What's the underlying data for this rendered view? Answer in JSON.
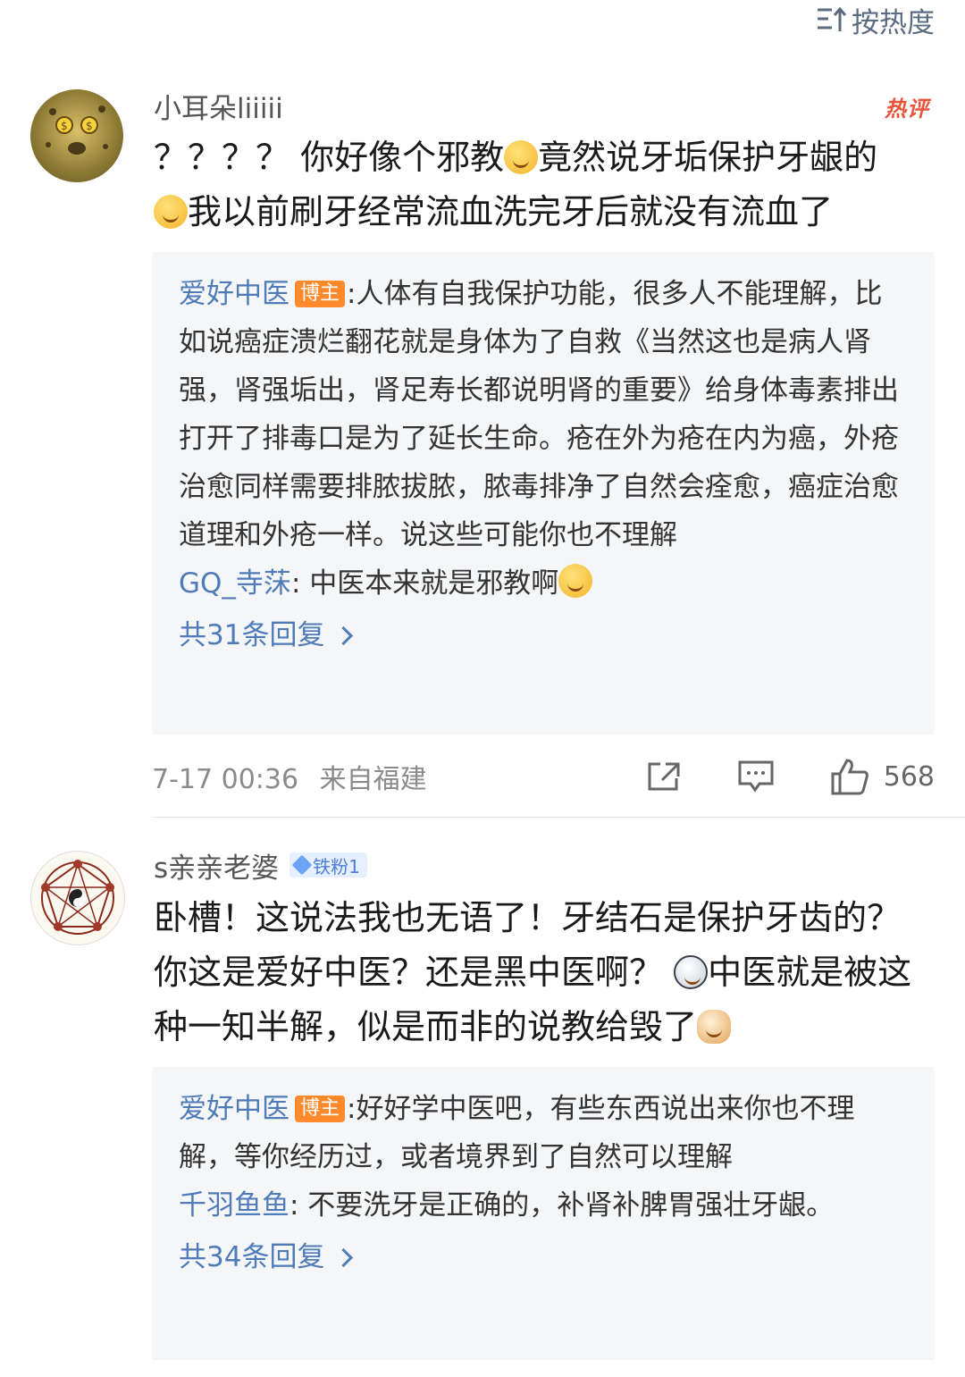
{
  "sort": {
    "label": "按热度"
  },
  "comments": [
    {
      "username": "小耳朵liiiii",
      "hot_label": "热评",
      "text_parts": [
        "？？？？ 你好像个邪教",
        "竟然说牙垢保护牙龈的",
        "我以前刷牙经常流血洗完牙后就没有流血了"
      ],
      "replies": [
        {
          "name": "爱好中医",
          "badge": "博主",
          "text": ":人体有自我保护功能，很多人不能理解，比如说癌症溃烂翻花就是身体为了自救《当然这也是病人肾强，肾强垢出，肾足寿长都说明肾的重要》给身体毒素排出打开了排毒口是为了延长生命。疮在外为疮在内为癌，外疮治愈同样需要排脓拔脓，脓毒排净了自然会痊愈，癌症治愈道理和外疮一样。说这些可能你也不理解"
        },
        {
          "name": "GQ_寺莯",
          "text": ": 中医本来就是邪教啊"
        }
      ],
      "more_replies": "共31条回复",
      "date": "7-17 00:36",
      "location": "来自福建",
      "likes": "568"
    },
    {
      "username": "s亲亲老婆",
      "fan_badge": "铁粉1",
      "text_parts": [
        "卧槽！这说法我也无语了！牙结石是保护牙齿的？你这是爱好中医？还是黑中医啊？",
        "中医就是被这种一知半解，似是而非的说教给毁了"
      ],
      "replies": [
        {
          "name": "爱好中医",
          "badge": "博主",
          "text": ":好好学中医吧，有些东西说出来你也不理解，等你经历过，或者境界到了自然可以理解"
        },
        {
          "name": "千羽鱼鱼",
          "text": ": 不要洗牙是正确的，补肾补脾胃强壮牙龈。"
        }
      ],
      "more_replies": "共34条回复"
    }
  ]
}
